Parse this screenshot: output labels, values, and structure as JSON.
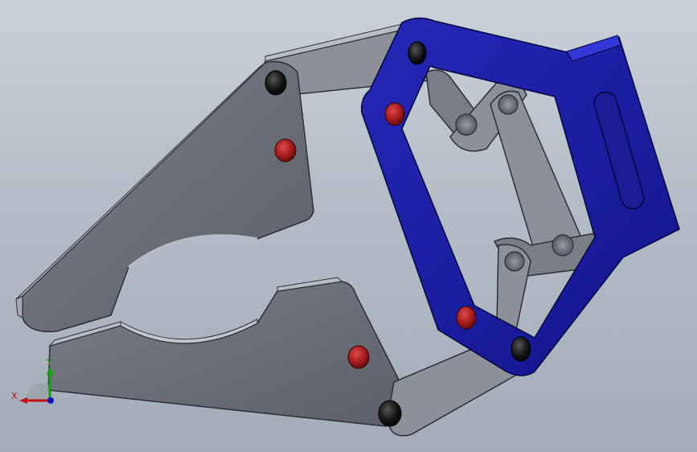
{
  "viewport": {
    "background_top": "#c9d0d8",
    "background_bottom": "#a3adb9"
  },
  "model": {
    "gray_part_color": "#6c6f78",
    "gray_part_edge": "#2d2f36",
    "gray_highlight": "#a9acb4",
    "blue_part_color": "#1c1fa0",
    "blue_part_edge": "#05063d",
    "red_fastener_color": "#a11a1a",
    "black_fastener_color": "#111111"
  },
  "triad": {
    "x_label": "X",
    "y_label": "Y",
    "x_color": "#c01010",
    "y_color": "#10a010",
    "z_color": "#1010c0"
  }
}
